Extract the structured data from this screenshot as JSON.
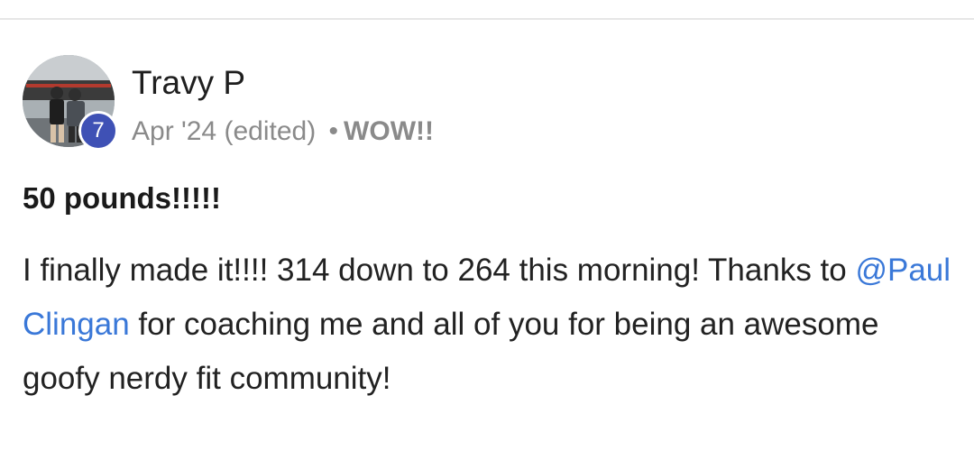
{
  "post": {
    "author": {
      "name": "Travy P",
      "level": "7"
    },
    "meta": {
      "date": "Apr '24",
      "edited": "(edited)",
      "separator": "•",
      "category": "WOW!!"
    },
    "title": "50 pounds!!!!!",
    "body": {
      "part1": "I finally made it!!!! 314 down to 264 this morning! Thanks to ",
      "mention": "@Paul Clingan",
      "part2": " for coaching me and all of you for being an awesome goofy nerdy fit community!"
    }
  },
  "colors": {
    "mention": "#3a78d8",
    "badge": "#3f51b5",
    "meta_text": "#8a8a8a"
  }
}
